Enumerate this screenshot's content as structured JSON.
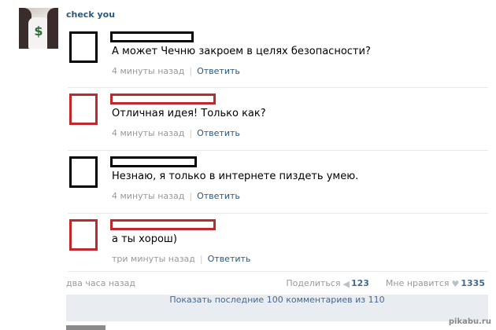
{
  "post": {
    "author": "check you",
    "time": "два часа назад"
  },
  "comments": [
    {
      "text": "А может Чечню закроем в целях безопасности?",
      "time": "4 минуты назад",
      "reply": "Ответить"
    },
    {
      "text": "Отличная идея! Только как?",
      "time": "4 минуты назад",
      "reply": "Ответить"
    },
    {
      "text": "Незнаю, я только в интернете пиздеть умею.",
      "time": "4 минуты назад",
      "reply": "Ответить"
    },
    {
      "text": "а ты хорош)",
      "time": "три минуты назад",
      "reply": "Ответить"
    }
  ],
  "actions": {
    "share_label": "Поделиться",
    "share_count": "123",
    "like_label": "Мне нравится",
    "like_count": "1335"
  },
  "show_more": "Показать последние 100 комментариев из 110",
  "watermark": "pikabu.ru",
  "colors": {
    "link": "#2b587a",
    "redacted_red": "#c0282d",
    "redacted_black": "#000000"
  }
}
